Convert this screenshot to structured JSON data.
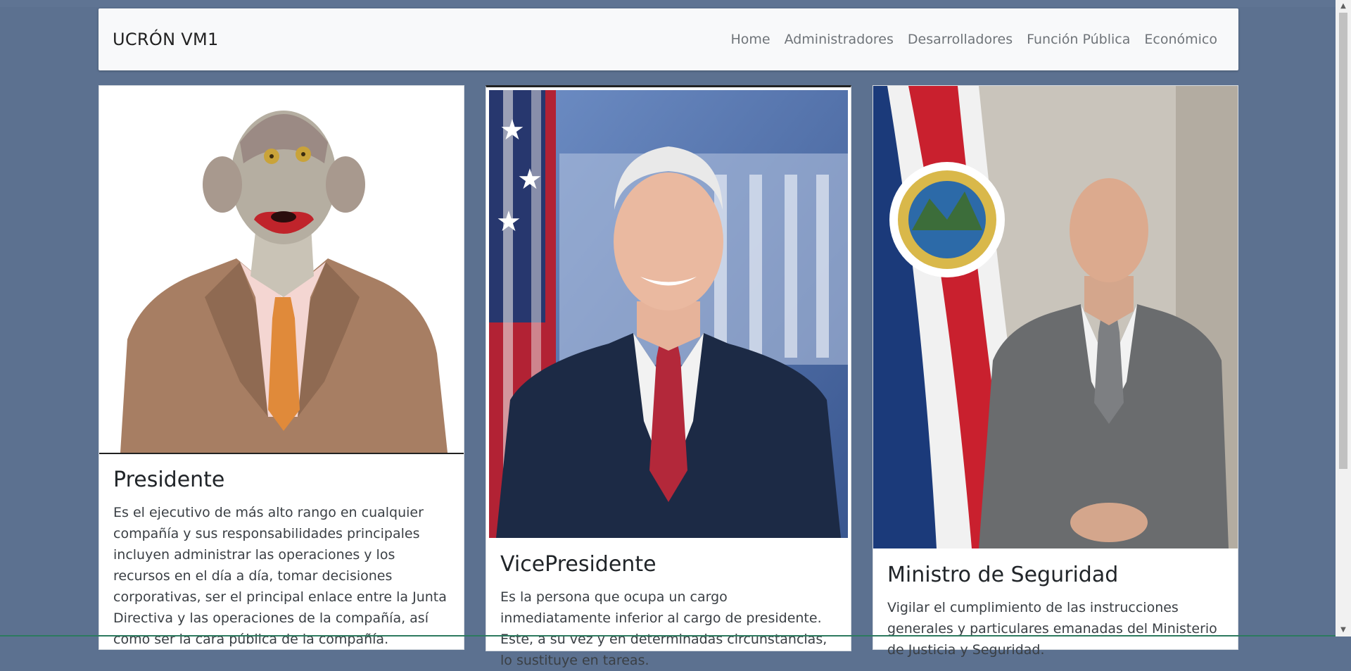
{
  "navbar": {
    "brand": "UCRÓN VM1",
    "links": [
      "Home",
      "Administradores",
      "Desarrolladores",
      "Función Pública",
      "Económico"
    ]
  },
  "cards": [
    {
      "title": "Presidente",
      "text": "Es el ejecutivo de más alto rango en cualquier compañía y sus responsabilidades principales incluyen administrar las operaciones y los recursos en el día a día, tomar decisiones corporativas, ser el principal enlace entre la Junta Directiva y las operaciones de la compañía, así como ser la cara pública de la compañía."
    },
    {
      "title": "VicePresidente",
      "text": "Es la persona que ocupa un cargo inmediatamente inferior al cargo de presidente. Este, a su vez y en determinadas circunstancias, lo sustituye en tareas."
    },
    {
      "title": "Ministro de Seguridad",
      "text": "Vigilar el cumplimiento de las instrucciones generales y particulares emanadas del Ministerio de Justicia y Seguridad."
    }
  ],
  "colors": {
    "background": "#5c7190",
    "navbar": "#f8f9fa",
    "nav_link": "#6f7479"
  }
}
